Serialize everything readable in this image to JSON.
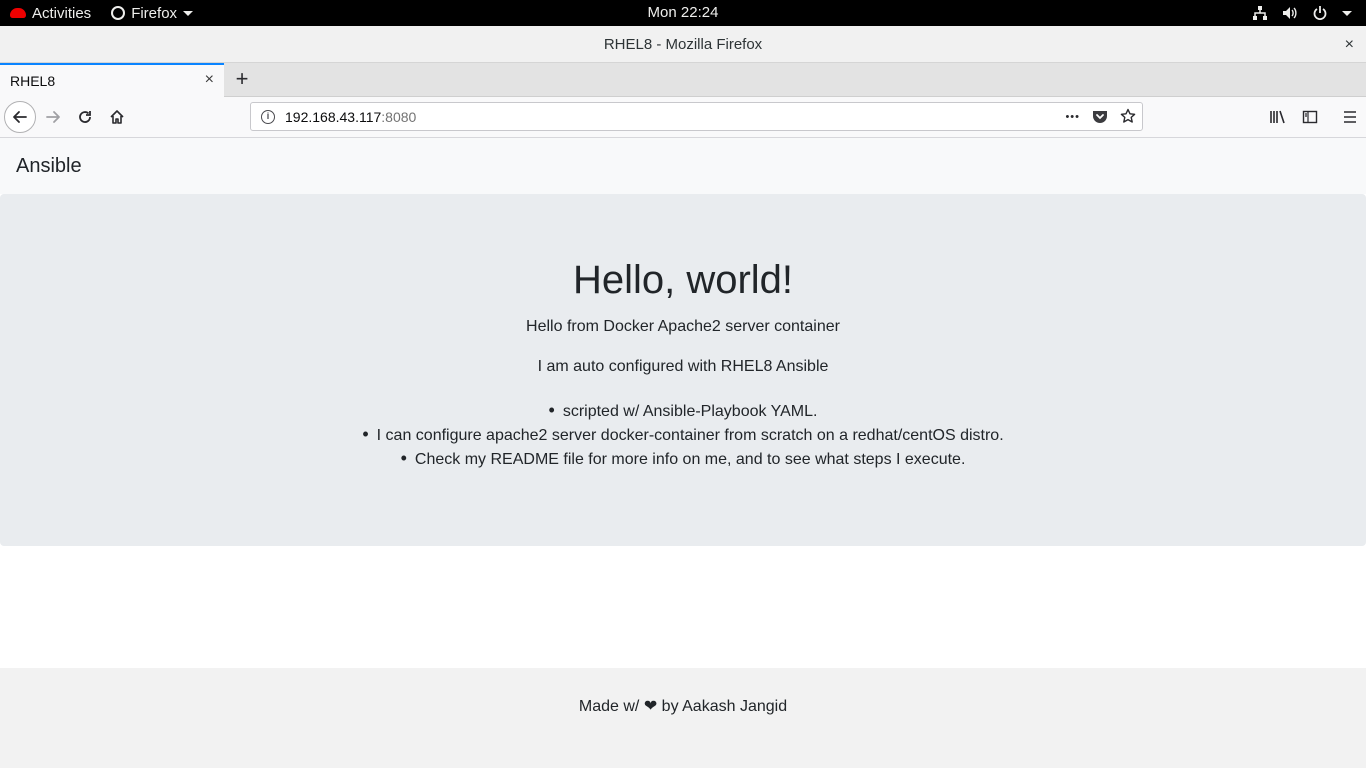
{
  "system_bar": {
    "activities_label": "Activities",
    "app_label": "Firefox",
    "clock": "Mon 22:24"
  },
  "window": {
    "title": "RHEL8 - Mozilla Firefox",
    "close_glyph": "×"
  },
  "tabs": [
    {
      "title": "RHEL8",
      "close_glyph": "×"
    }
  ],
  "newtab_glyph": "+",
  "urlbar": {
    "host": "192.168.43.117",
    "port": ":8080",
    "more_glyph": "•••"
  },
  "site": {
    "brand": "Ansible",
    "heading": "Hello, world!",
    "lead1": "Hello from Docker Apache2 server container",
    "lead2": "I am auto configured with RHEL8 Ansible",
    "points": [
      "scripted w/ Ansible-Playbook YAML.",
      "I can configure apache2 server docker-container from scratch on a redhat/centOS distro.",
      "Check my README file for more info on me, and to see what steps I execute."
    ],
    "footer": "Made w/ ❤ by Aakash Jangid"
  },
  "colors": {
    "accent": "#0a84ff",
    "jumbotron_bg": "#e9ecef",
    "nav_bg": "#f8f9fa",
    "footer_bg": "#f2f2f2",
    "redhat": "#ee0000"
  }
}
